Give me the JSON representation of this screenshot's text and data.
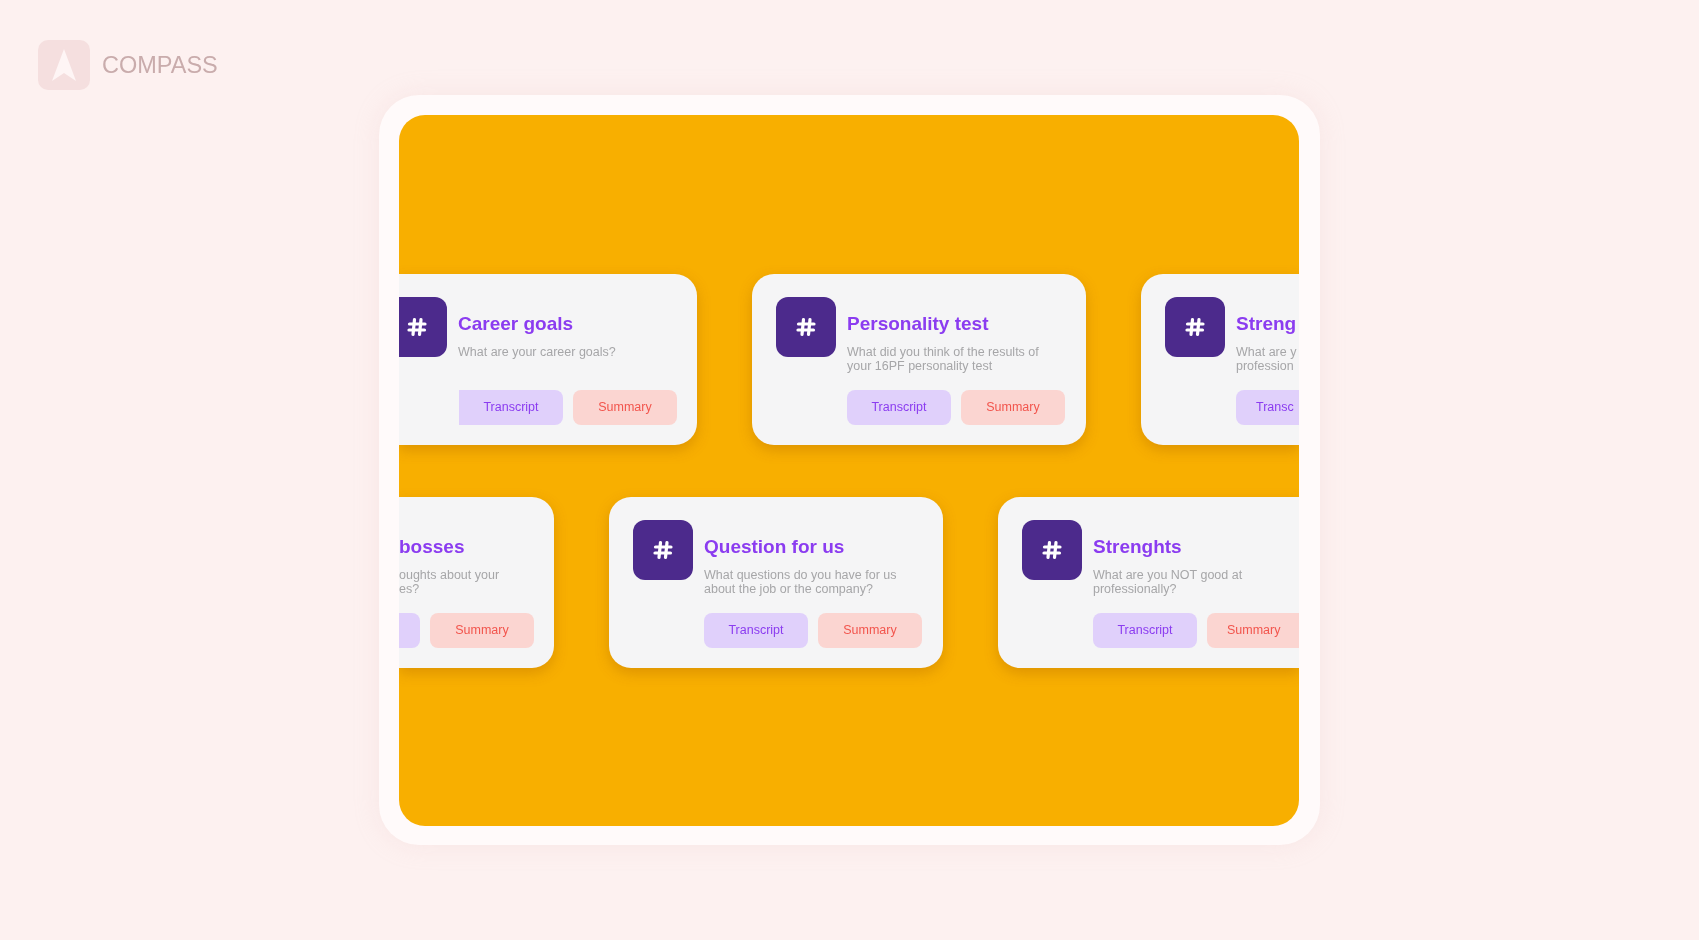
{
  "logo": {
    "name": "COMPASS"
  },
  "rows": [
    {
      "cards": [
        {
          "title": "Career goals",
          "description": "What are your career goals?",
          "buttons": [
            {
              "kind": "transcript",
              "label": "Transcript"
            },
            {
              "kind": "summary",
              "label": "Summary"
            }
          ]
        },
        {
          "title": "Personality test",
          "description": "What did you think of the results of\nyour 16PF personality test",
          "buttons": [
            {
              "kind": "transcript",
              "label": "Transcript"
            },
            {
              "kind": "summary",
              "label": "Summary"
            }
          ]
        },
        {
          "title": "Streng",
          "description": "What are y\nprofession",
          "buttons": [
            {
              "kind": "transcript",
              "label": "Transc"
            }
          ]
        }
      ]
    },
    {
      "cards": [
        {
          "title": "bosses",
          "description": "oughts about your\nes?",
          "buttons": [
            {
              "kind": "transcript"
            },
            {
              "kind": "summary",
              "label": "Summary"
            }
          ]
        },
        {
          "title": "Question for us",
          "description": "What questions do you have for us\nabout the job or the company?",
          "buttons": [
            {
              "kind": "transcript",
              "label": "Transcript"
            },
            {
              "kind": "summary",
              "label": "Summary"
            }
          ]
        },
        {
          "title": "Strenghts",
          "description": "What are you NOT good at\nprofessionally?",
          "buttons": [
            {
              "kind": "transcript",
              "label": "Transcript"
            },
            {
              "kind": "summary",
              "label": "Summary"
            }
          ]
        }
      ]
    }
  ]
}
